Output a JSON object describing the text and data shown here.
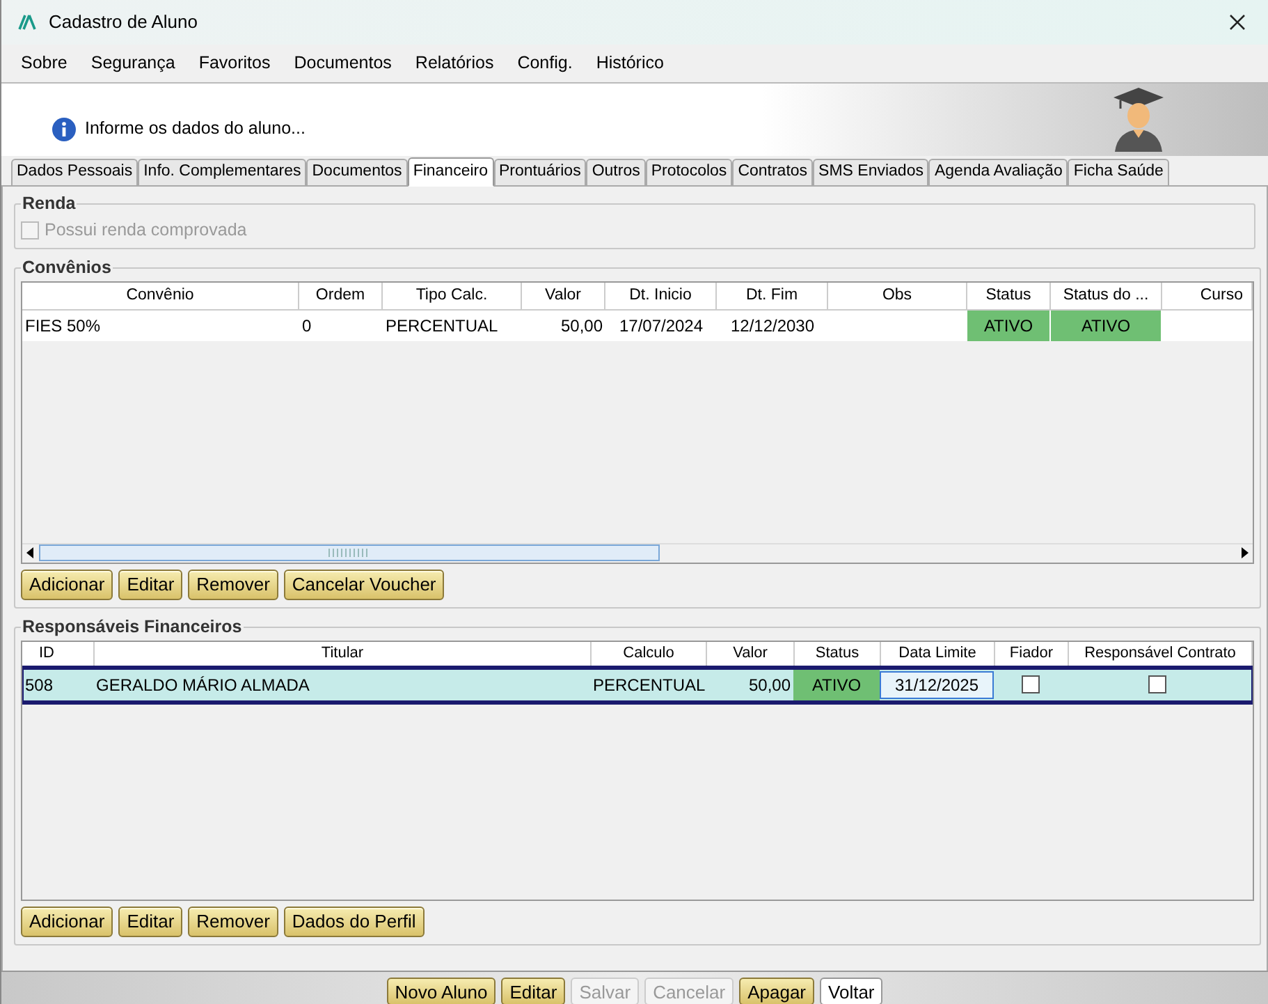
{
  "window": {
    "title": "Cadastro de Aluno"
  },
  "menu": [
    "Sobre",
    "Segurança",
    "Favoritos",
    "Documentos",
    "Relatórios",
    "Config.",
    "Histórico"
  ],
  "header": {
    "message": "Informe os dados do aluno..."
  },
  "tabs": [
    {
      "label": "Dados Pessoais",
      "selected": false
    },
    {
      "label": "Info. Complementares",
      "selected": false
    },
    {
      "label": "Documentos",
      "selected": false
    },
    {
      "label": "Financeiro",
      "selected": true
    },
    {
      "label": "Prontuários",
      "selected": false
    },
    {
      "label": "Outros",
      "selected": false
    },
    {
      "label": "Protocolos",
      "selected": false
    },
    {
      "label": "Contratos",
      "selected": false
    },
    {
      "label": "SMS Enviados",
      "selected": false
    },
    {
      "label": "Agenda Avaliação",
      "selected": false
    },
    {
      "label": "Ficha Saúde",
      "selected": false
    }
  ],
  "renda": {
    "title": "Renda",
    "checkbox": {
      "label": "Possui renda comprovada",
      "checked": false,
      "disabled": true
    }
  },
  "convenios": {
    "title": "Convênios",
    "columns": [
      "Convênio",
      "Ordem",
      "Tipo Calc.",
      "Valor",
      "Dt. Inicio",
      "Dt. Fim",
      "Obs",
      "Status",
      "Status do ...",
      "Curso"
    ],
    "rows": [
      {
        "cells": [
          "FIES 50%",
          "0",
          "PERCENTUAL",
          "50,00",
          "17/07/2024",
          "12/12/2030",
          "",
          "ATIVO",
          "ATIVO",
          ""
        ]
      }
    ],
    "buttons": [
      "Adicionar",
      "Editar",
      "Remover",
      "Cancelar Voucher"
    ]
  },
  "responsaveis": {
    "title": "Responsáveis Financeiros",
    "columns": [
      "ID",
      "Titular",
      "Calculo",
      "Valor",
      "Status",
      "Data Limite",
      "Fiador",
      "Responsável Contrato"
    ],
    "rows": [
      {
        "selected": true,
        "id": "508",
        "titular": "GERALDO MÁRIO ALMADA",
        "calculo": "PERCENTUAL",
        "valor": "50,00",
        "status": "ATIVO",
        "data_limite": "31/12/2025",
        "fiador": false,
        "responsavel_contrato": false
      }
    ],
    "buttons": [
      "Adicionar",
      "Editar",
      "Remover",
      "Dados do Perfil"
    ]
  },
  "footer_buttons": [
    {
      "label": "Novo Aluno",
      "disabled": false,
      "kind": "gold"
    },
    {
      "label": "Editar",
      "disabled": false,
      "kind": "gold"
    },
    {
      "label": "Salvar",
      "disabled": true,
      "kind": "gold"
    },
    {
      "label": "Cancelar",
      "disabled": true,
      "kind": "gold"
    },
    {
      "label": "Apagar",
      "disabled": false,
      "kind": "gold"
    },
    {
      "label": "Voltar",
      "disabled": false,
      "kind": "plain"
    }
  ]
}
